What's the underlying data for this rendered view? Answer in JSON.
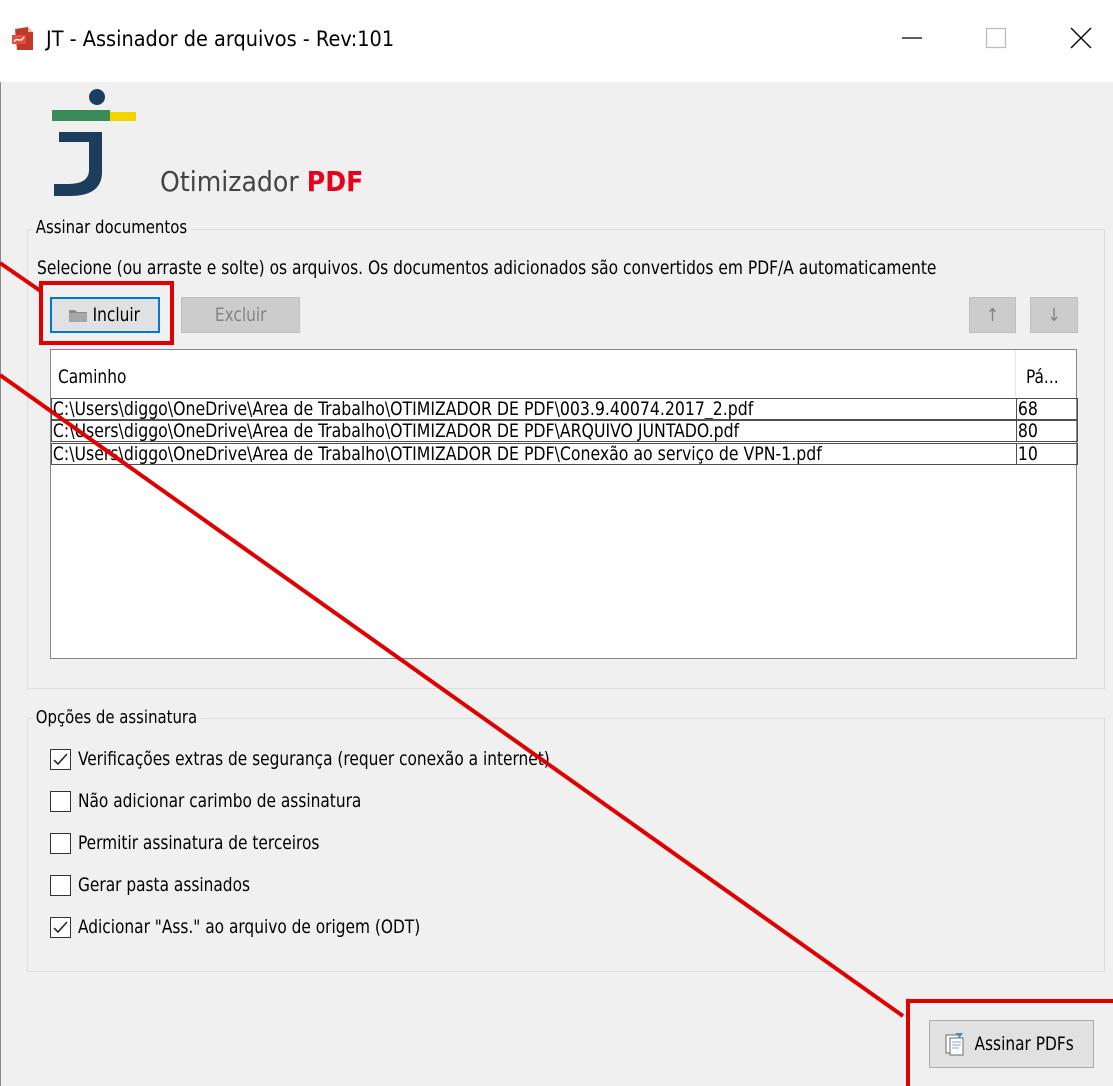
{
  "window": {
    "title": "JT - Assinador de arquivos - Rev:101",
    "controls": [
      "minimize",
      "maximize",
      "close"
    ]
  },
  "brand": {
    "name": "Otimizador",
    "accent": "PDF",
    "accent_color": "#e8001a"
  },
  "sign_group": {
    "label": "Assinar documentos",
    "instructions": "Selecione (ou arraste e solte) os arquivos. Os documentos adicionados são convertidos em PDF/A automaticamente",
    "include_label": "Incluir",
    "exclude_label": "Excluir",
    "up_label": "↑",
    "down_label": "↓"
  },
  "files_table": {
    "columns": [
      "Caminho",
      "Pá..."
    ],
    "rows": [
      {
        "path": "C:\\Users\\diggo\\OneDrive\\Area de Trabalho\\OTIMIZADOR DE PDF\\003.9.40074.2017_2.pdf",
        "pages": "68"
      },
      {
        "path": "C:\\Users\\diggo\\OneDrive\\Area de Trabalho\\OTIMIZADOR DE PDF\\ARQUIVO JUNTADO.pdf",
        "pages": "80"
      },
      {
        "path": "C:\\Users\\diggo\\OneDrive\\Area de Trabalho\\OTIMIZADOR DE PDF\\Conexão ao serviço de VPN-1.pdf",
        "pages": "10"
      }
    ]
  },
  "options_group": {
    "label": "Opções de assinatura",
    "options": [
      {
        "label": "Verificações extras de segurança (requer conexão a internet)",
        "checked": true
      },
      {
        "label": "Não adicionar carimbo de assinatura",
        "checked": false
      },
      {
        "label": "Permitir assinatura de terceiros",
        "checked": false
      },
      {
        "label": "Gerar pasta assinados",
        "checked": false
      },
      {
        "label": "Adicionar \"Ass.\" ao arquivo de origem (ODT)",
        "checked": true
      }
    ]
  },
  "sign_button": {
    "label": "Assinar PDFs"
  },
  "annotation_color": "#e00000"
}
